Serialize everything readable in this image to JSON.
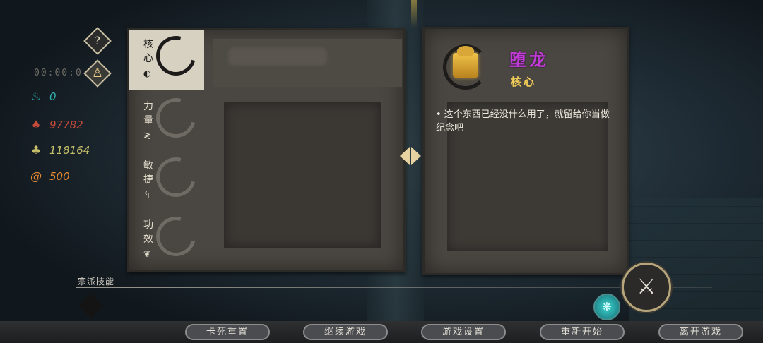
{
  "hud": {
    "help_icon": "?",
    "portrait_icon": "portrait-icon",
    "timer": "00:00:0",
    "resources": [
      {
        "icon": "flame-icon",
        "glyph": "♨",
        "color": "#2fb3b3",
        "value": "0"
      },
      {
        "icon": "fire-icon",
        "glyph": "♠",
        "color": "#c54a3a",
        "value": "97782"
      },
      {
        "icon": "swirl-icon",
        "glyph": "♣",
        "color": "#c7c06a",
        "value": "118164"
      },
      {
        "icon": "spiral-icon",
        "glyph": "@",
        "color": "#e4892f",
        "value": "500"
      }
    ]
  },
  "left_panel": {
    "tabs": [
      {
        "label": "核心",
        "symbol": "◐",
        "active": true
      },
      {
        "label": "力量",
        "symbol": "≷",
        "active": false
      },
      {
        "label": "敏捷",
        "symbol": "↰",
        "active": false
      },
      {
        "label": "功效",
        "symbol": "❦",
        "active": false
      }
    ]
  },
  "item": {
    "name": "堕龙",
    "name_color": "#c13bd8",
    "type": "核心",
    "description": "• 这个东西已经没什么用了，就留给你当做纪念吧"
  },
  "skills": {
    "label": "宗派技能"
  },
  "menu": [
    "卡死重置",
    "继续游戏",
    "游戏设置",
    "重新开始",
    "离开游戏"
  ]
}
